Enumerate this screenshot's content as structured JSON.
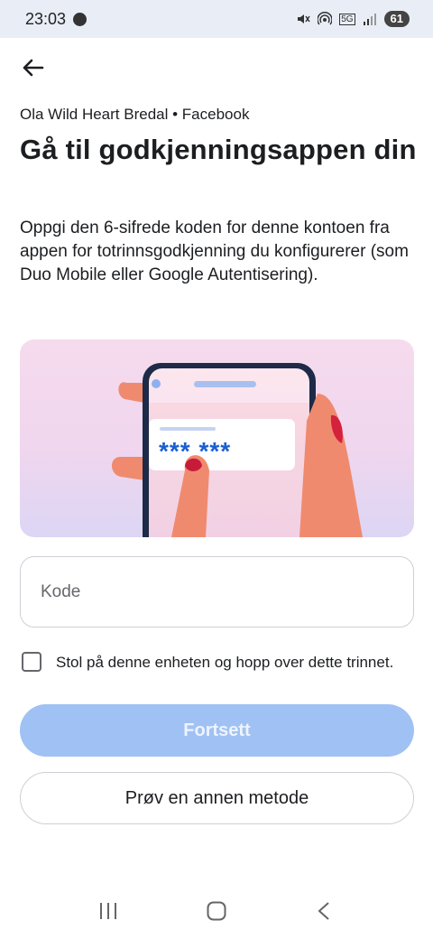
{
  "status_bar": {
    "time": "23:03",
    "battery": "61",
    "network": "5G"
  },
  "header": {
    "account": "Ola Wild Heart Bredal • Facebook",
    "title": "Gå til godkjenningsappen din",
    "description": "Oppgi den 6-sifrede koden for denne kontoen fra appen for totrinnsgodkjenning du konfigurerer (som Duo Mobile eller Google Autentisering)."
  },
  "illustration": {
    "code_text": "*** ***",
    "accent_color": "#1b5fd1",
    "background_color": "#f3d9ee"
  },
  "form": {
    "code_placeholder": "Kode",
    "code_value": "",
    "trust_label": "Stol på denne enheten og hopp over dette trinnet.",
    "trust_checked": false,
    "continue_label": "Fortsett",
    "other_method_label": "Prøv en annen metode"
  },
  "colors": {
    "primary_disabled": "#a0c1f3",
    "text": "#1c1e21",
    "border": "#ccd0d5"
  },
  "icons": {
    "back": "arrow-left-icon",
    "nav_recent": "recent-apps-icon",
    "nav_home": "home-icon",
    "nav_back": "back-nav-icon"
  }
}
